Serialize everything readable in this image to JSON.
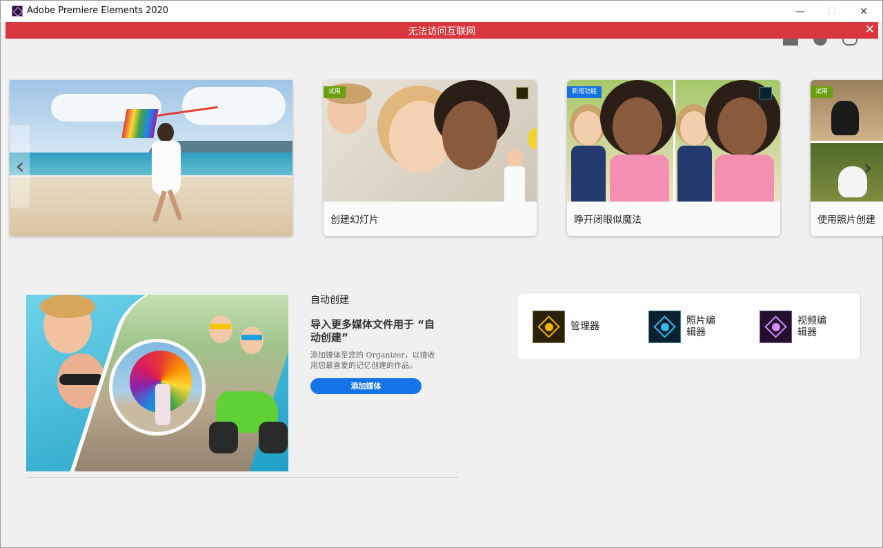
{
  "window": {
    "title": "Adobe Premiere Elements 2020",
    "controls": {
      "minimize": "—",
      "maximize": "☐",
      "close": "✕"
    }
  },
  "banner": {
    "text": "无法访问互联网",
    "close": "✕"
  },
  "social": [
    "facebook-icon",
    "twitter-icon",
    "chat-icon"
  ],
  "carousel": {
    "prev": "‹",
    "next": "›",
    "cards": [
      {
        "label": "创建幻灯片",
        "tag": "试用"
      },
      {
        "label": "睁开闭眼似魔法",
        "tag": "新增功能"
      },
      {
        "label": "使用照片创建",
        "tag": "试用"
      }
    ]
  },
  "auto_create": {
    "section_title": "自动创建",
    "heading": "导入更多媒体文件用于 “自动创建”",
    "description": "添加媒体至您的 Organizer，以接收用您最喜爱的记忆创建的作品。",
    "button": "添加媒体"
  },
  "launch": {
    "items": [
      {
        "label": "管理器",
        "icon": "organizer-icon"
      },
      {
        "label": "照片编\n辑器",
        "icon": "photo-editor-icon"
      },
      {
        "label": "视频编\n辑器",
        "icon": "video-editor-icon"
      }
    ]
  },
  "colors": {
    "banner": "#d9363e",
    "accent": "#1473e6",
    "trial_tag": "#6aa010",
    "new_tag": "#1473e6"
  }
}
